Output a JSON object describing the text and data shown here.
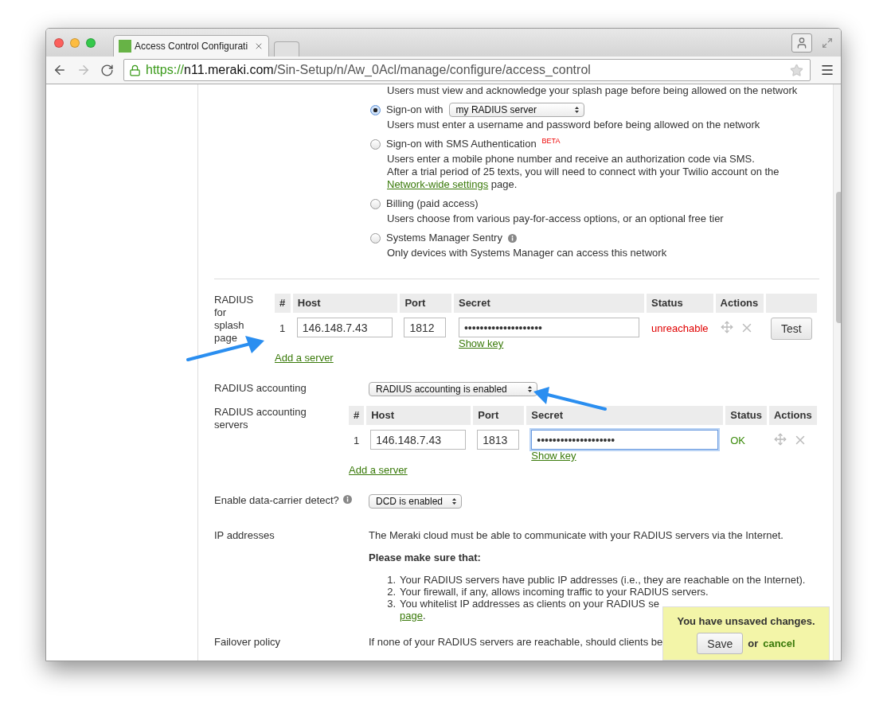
{
  "browser": {
    "tab_title": "Access Control Configurati",
    "url_scheme": "https://",
    "url_host": "n11.meraki.com",
    "url_path": "/Sin-Setup/n/Aw_0Acl/manage/configure/access_control"
  },
  "splash": {
    "cut_text": "Users must view and acknowledge your splash page before being allowed on the network",
    "options": [
      {
        "label": "Sign-on with",
        "selected": true,
        "select": "my RADIUS server",
        "description": "Users must enter a username and password before being allowed on the network"
      },
      {
        "label": "Sign-on with SMS Authentication",
        "selected": false,
        "badge": "BETA",
        "description": "Users enter a mobile phone number and receive an authorization code via SMS.",
        "note": {
          "text": "After a trial period of 25 texts, you will need to connect with your Twilio account on the",
          "link": "Network-wide settings",
          "after": "page."
        }
      },
      {
        "label": "Billing (paid access)",
        "selected": false,
        "description": "Users choose from various pay-for-access options, or an optional free tier"
      },
      {
        "label": "Systems Manager Sentry",
        "selected": false,
        "info": true,
        "description": "Only devices with Systems Manager can access this network"
      }
    ]
  },
  "radius_servers": {
    "label": "RADIUS for splash page",
    "columns": [
      "#",
      "Host",
      "Port",
      "Secret",
      "Status",
      "Actions"
    ],
    "rows": [
      {
        "number": "1",
        "host": "146.148.7.43",
        "port": "1812",
        "secret": "••••••••••••••••••••",
        "focused": false,
        "show_key": "Show key",
        "status": "unreachable",
        "color": "#e00000",
        "test_button": "Test"
      }
    ],
    "add_link": "Add a server"
  },
  "accounting": {
    "label": "RADIUS accounting",
    "select": "RADIUS accounting is enabled"
  },
  "accounting_servers": {
    "label": "RADIUS accounting servers",
    "columns": [
      "#",
      "Host",
      "Port",
      "Secret",
      "Status",
      "Actions"
    ],
    "rows": [
      {
        "number": "1",
        "host": "146.148.7.43",
        "port": "1813",
        "secret": "••••••••••••••••••••",
        "focused": true,
        "show_key": "Show key",
        "status": "OK",
        "color": "#3a8a0a"
      }
    ],
    "add_link": "Add a server"
  },
  "dcd": {
    "label": "Enable data-carrier detect?",
    "info": true,
    "select": "DCD is enabled"
  },
  "ip_addresses": {
    "label": "IP addresses",
    "intro": "The Meraki cloud must be able to communicate with your RADIUS servers via the Internet.",
    "heading": "Please make sure that:",
    "items": [
      {
        "number": "1.",
        "text": "Your RADIUS servers have public IP addresses (i.e., they are reachable on the Internet)."
      },
      {
        "number": "2.",
        "text": "Your firewall, if any, allows incoming traffic to your RADIUS servers."
      },
      {
        "number": "3.",
        "text": "You whitelist IP addresses as clients on your RADIUS se",
        "link": "page",
        "after": "."
      }
    ]
  },
  "failover": {
    "label": "Failover policy",
    "text": "If none of your RADIUS servers are reachable, should clients be"
  },
  "unsaved": {
    "message": "You have unsaved changes.",
    "save_button": "Save",
    "or": "or",
    "cancel_link": "cancel"
  }
}
